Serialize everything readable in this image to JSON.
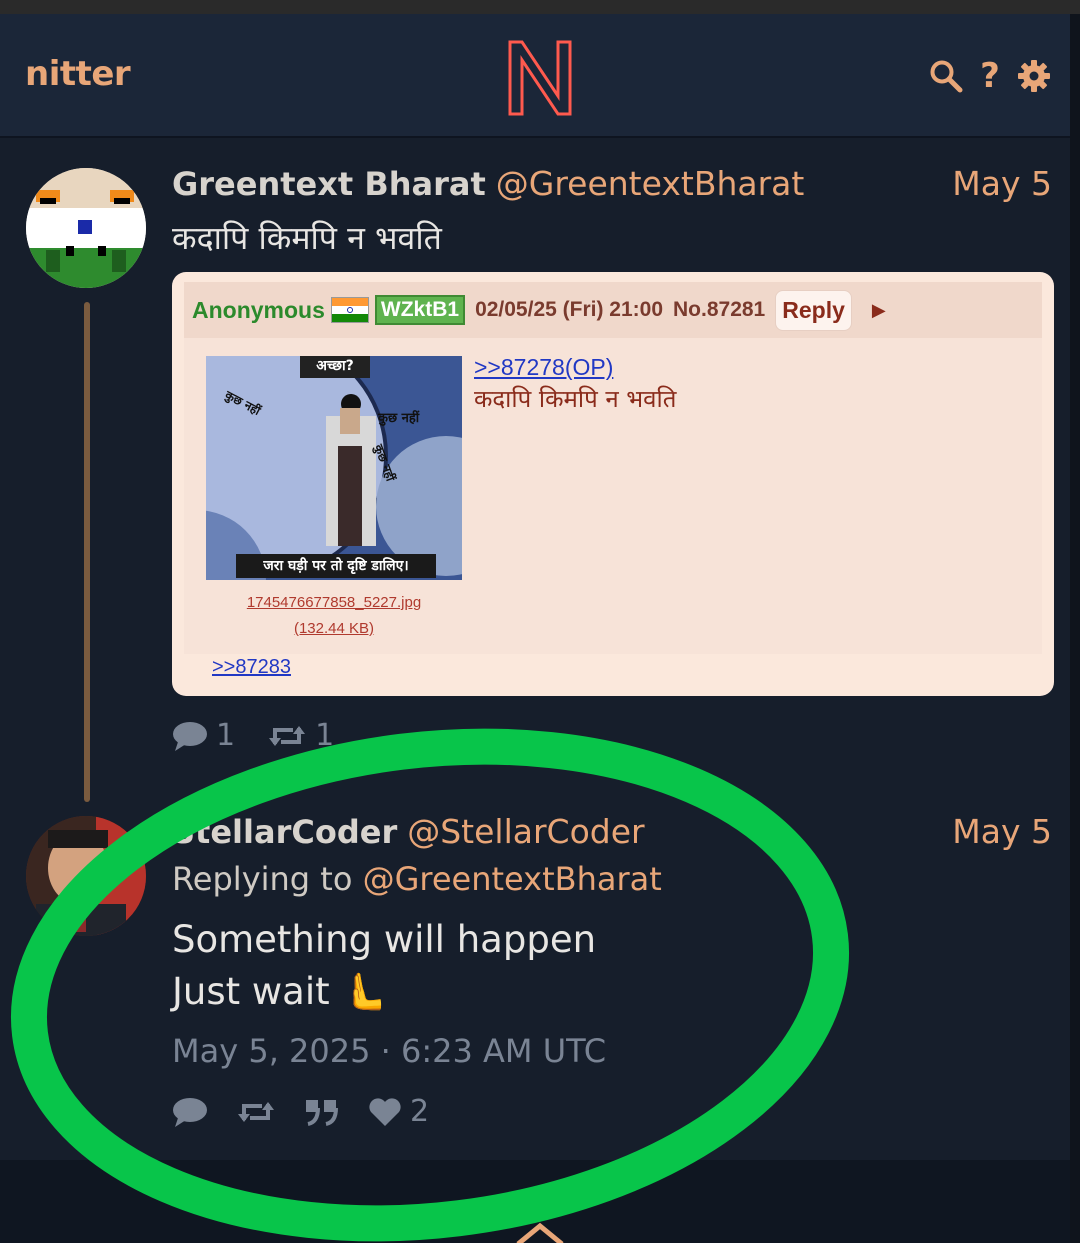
{
  "nav": {
    "brand": "nitter",
    "logo_letter": "N",
    "accent": "#e8a678"
  },
  "tweet1": {
    "fullname": "Greentext Bharat",
    "username": "@GreentextBharat",
    "date": "May 5",
    "text": "कदापि किमपि न भवति",
    "embed": {
      "name": "Anonymous",
      "id": "WZktB1",
      "datetime": "02/05/25 (Fri) 21:00",
      "post_no": "No.87281",
      "reply_label": "Reply",
      "quote": ">>87278(OP)",
      "post_text": "कदापि किमपि न भवति",
      "filename": "1745476677858_5227.jpg",
      "filesize": "(132.44 KB)",
      "backlink": ">>87283",
      "image_caption_top": "अच्छा?",
      "image_caption_bottom": "जरा घड़ी पर तो दृष्टि डालिए।",
      "image_label_1": "कुछ नहीं",
      "image_label_2": "कुछ नहीं",
      "image_label_3": "कुछ नहीं"
    },
    "stats": {
      "comments": "1",
      "retweets": "1"
    }
  },
  "tweet2": {
    "fullname": "StellarCoder",
    "username": "@StellarCoder",
    "date": "May 5",
    "replying_prefix": "Replying to",
    "replying_to": "@GreentextBharat",
    "line1": "Something will happen",
    "line2": "Just wait 🫷",
    "published": "May 5, 2025 · 6:23 AM UTC",
    "stats": {
      "likes": "2"
    }
  }
}
